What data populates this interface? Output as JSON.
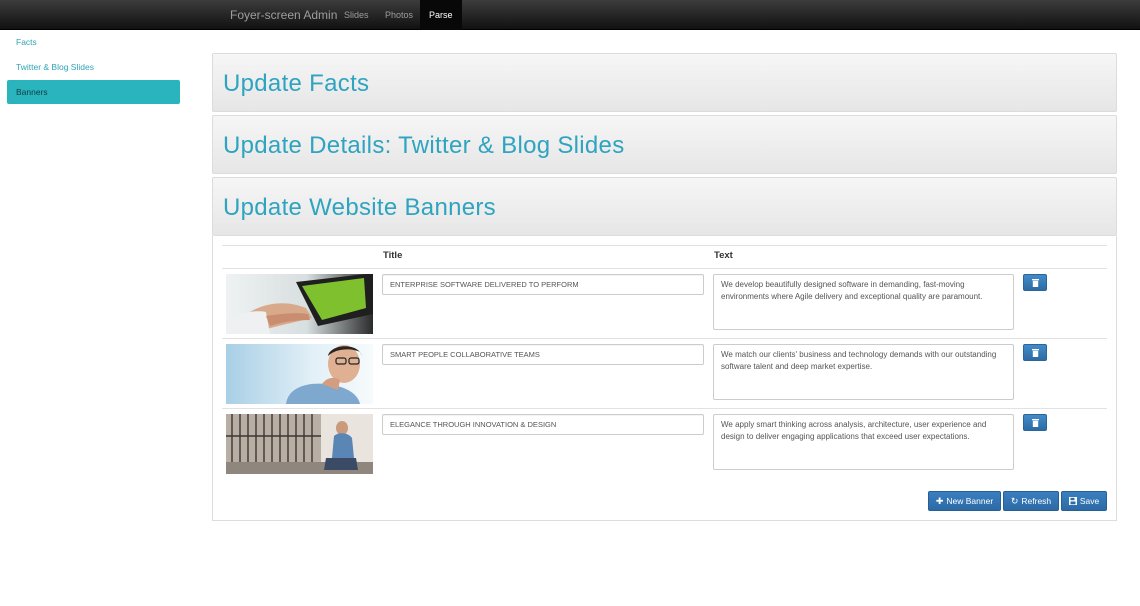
{
  "navbar": {
    "brand": "Foyer-screen Admin",
    "items": [
      {
        "label": "Slides",
        "active": false
      },
      {
        "label": "Photos",
        "active": false
      },
      {
        "label": "Parse",
        "active": true
      }
    ]
  },
  "sidebar": {
    "items": [
      {
        "label": "Facts",
        "active": false
      },
      {
        "label": "Twitter & Blog Slides",
        "active": false
      },
      {
        "label": "Banners",
        "active": true
      }
    ]
  },
  "panels": {
    "facts": "Update Facts",
    "details": "Update Details: Twitter & Blog Slides",
    "banners": "Update Website Banners"
  },
  "table": {
    "headers": {
      "title": "Title",
      "text": "Text"
    },
    "rows": [
      {
        "image": "tablet-hand-photo",
        "title": "ENTERPRISE SOFTWARE DELIVERED TO PERFORM",
        "text": "We develop beautifully designed software in demanding, fast-moving environments where Agile delivery and exceptional quality are paramount."
      },
      {
        "image": "smiling-man-glasses-photo",
        "title": "SMART PEOPLE COLLABORATIVE TEAMS",
        "text": "We match our clients' business and technology demands with our outstanding software talent and deep market expertise."
      },
      {
        "image": "man-sitting-street-photo",
        "title": "ELEGANCE THROUGH INNOVATION & DESIGN",
        "text": "We apply smart thinking across analysis, architecture, user experience and design to deliver engaging applications that exceed user expectations."
      }
    ]
  },
  "actions": {
    "new_banner": "New Banner",
    "refresh": "Refresh",
    "save": "Save"
  },
  "colors": {
    "accent": "#2fa4c0",
    "active_sidebar": "#2ab5be",
    "button": "#337ab7"
  }
}
